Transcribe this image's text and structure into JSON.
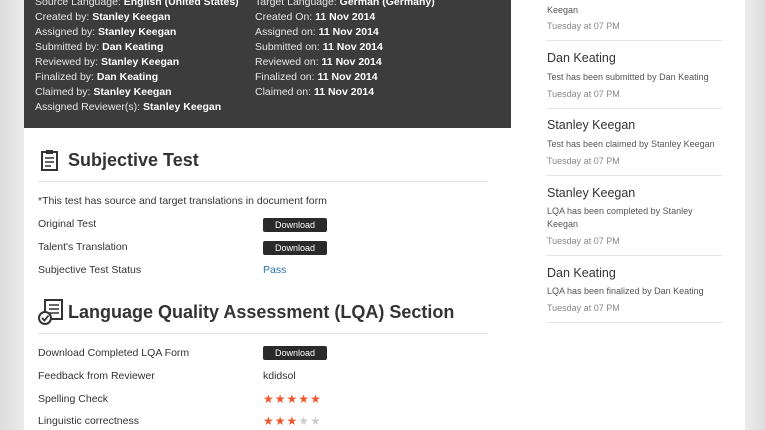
{
  "info": {
    "left": [
      {
        "label": "Source Language:",
        "value": "English (United States)"
      },
      {
        "label": "Created by:",
        "value": "Stanley Keegan"
      },
      {
        "label": "Assigned by:",
        "value": "Stanley Keegan"
      },
      {
        "label": "Submitted by:",
        "value": "Dan Keating"
      },
      {
        "label": "Reviewed by:",
        "value": "Stanley Keegan"
      },
      {
        "label": "Finalized by:",
        "value": "Dan Keating"
      },
      {
        "label": "Claimed by:",
        "value": "Stanley Keegan"
      },
      {
        "label": "Assigned Reviewer(s):",
        "value": "Stanley Keegan"
      }
    ],
    "right": [
      {
        "label": "Target Language:",
        "value": "German (Germany)"
      },
      {
        "label": "Created On:",
        "value": "11 Nov 2014"
      },
      {
        "label": "Assigned on:",
        "value": "11 Nov 2014"
      },
      {
        "label": "Submitted on:",
        "value": "11 Nov 2014"
      },
      {
        "label": "Reviewed on:",
        "value": "11 Nov 2014"
      },
      {
        "label": "Finalized on:",
        "value": "11 Nov 2014"
      },
      {
        "label": "Claimed on:",
        "value": "11 Nov 2014"
      }
    ]
  },
  "subjective": {
    "title": "Subjective Test",
    "note": "*This test has source and target translations in document form",
    "original_label": "Original Test",
    "translation_label": "Talent's Translation",
    "status_label": "Subjective Test Status",
    "status_value": "Pass",
    "download_label": "Download"
  },
  "lqa": {
    "title": "Language Quality Assessment (LQA) Section",
    "download_form_label": "Download Completed LQA Form",
    "download_label": "Download",
    "feedback_label": "Feedback from Reviewer",
    "feedback_value": "kdidsol",
    "ratings": [
      {
        "label": "Spelling Check",
        "stars": 5,
        "max": 5
      },
      {
        "label": "Linguistic correctness",
        "stars": 3,
        "max": 5
      }
    ]
  },
  "feed": {
    "top_cut": {
      "text": "Keegan",
      "time": "Tuesday at 07 PM"
    },
    "items": [
      {
        "name": "Dan Keating",
        "text": "Test has been submitted by Dan Keating",
        "time": "Tuesday at 07 PM"
      },
      {
        "name": "Stanley Keegan",
        "text": "Test has been claimed by Stanley Keegan",
        "time": "Tuesday at 07 PM"
      },
      {
        "name": "Stanley Keegan",
        "text": "LQA has been completed by Stanley Keegan",
        "time": "Tuesday at 07 PM"
      },
      {
        "name": "Dan Keating",
        "text": "LQA has been finalized by Dan Keating",
        "time": "Tuesday at 07 PM"
      }
    ]
  },
  "colors": {
    "accent_star": "#f0562b",
    "link": "#2b72b8",
    "panel": "#3c3c3c"
  }
}
